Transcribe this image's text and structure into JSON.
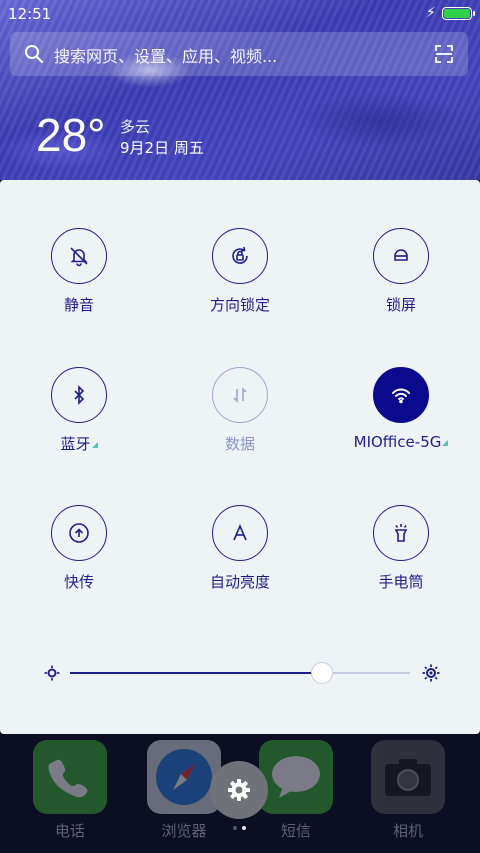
{
  "status_bar": {
    "time": "12:51",
    "battery_color": "#31d04a"
  },
  "search": {
    "placeholder": "搜索网页、设置、应用、视频..."
  },
  "weather": {
    "temperature": "28°",
    "condition": "多云",
    "date": "9月2日 周五"
  },
  "quick_settings": {
    "tiles": [
      {
        "label": "静音",
        "icon": "bell-off-icon",
        "state": "off"
      },
      {
        "label": "方向锁定",
        "icon": "rotation-lock-icon",
        "state": "off"
      },
      {
        "label": "锁屏",
        "icon": "lock-icon",
        "state": "off"
      },
      {
        "label": "蓝牙",
        "icon": "bluetooth-icon",
        "state": "off",
        "expandable": true
      },
      {
        "label": "数据",
        "icon": "data-arrows-icon",
        "state": "disabled"
      },
      {
        "label": "MIOffice-5G",
        "icon": "wifi-icon",
        "state": "on",
        "expandable": true
      },
      {
        "label": "快传",
        "icon": "transfer-icon",
        "state": "off"
      },
      {
        "label": "自动亮度",
        "icon": "auto-brightness-icon",
        "state": "off"
      },
      {
        "label": "手电筒",
        "icon": "flashlight-icon",
        "state": "off"
      }
    ],
    "brightness": {
      "value": 0.74
    },
    "accent_color": "#1e1e8a"
  },
  "dock": {
    "apps": [
      {
        "label": "电话",
        "icon": "phone-icon",
        "color": "#3fb23a"
      },
      {
        "label": "浏览器",
        "icon": "compass-icon",
        "color": "#d9dde6"
      },
      {
        "label": "短信",
        "icon": "message-icon",
        "color": "#3fb23a"
      },
      {
        "label": "相机",
        "icon": "camera-icon",
        "color": "#5a5a5a"
      }
    ],
    "page_indicator": {
      "pages": 2,
      "current": 2
    }
  }
}
